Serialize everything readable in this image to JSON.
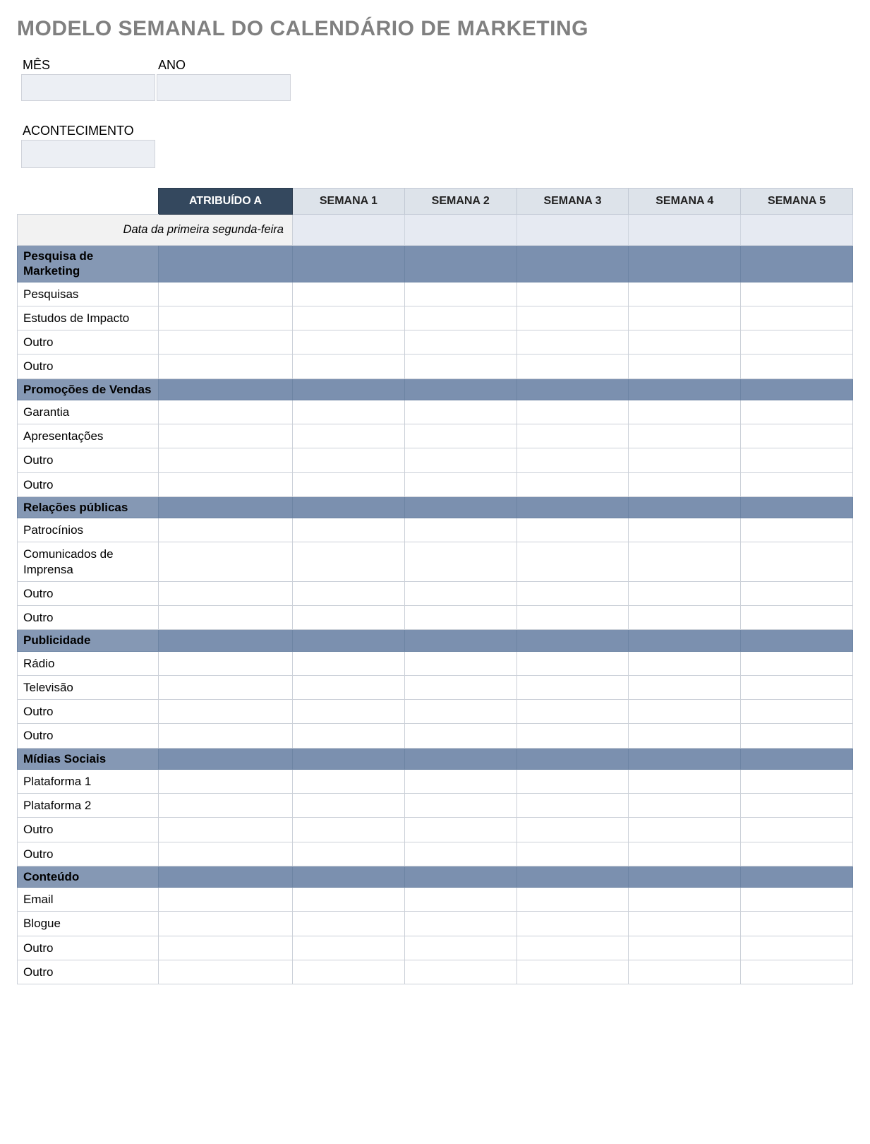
{
  "title": "MODELO SEMANAL DO CALENDÁRIO DE MARKETING",
  "meta": {
    "month_label": "MÊS",
    "month_value": "",
    "year_label": "ANO",
    "year_value": "",
    "event_label": "ACONTECIMENTO",
    "event_value": ""
  },
  "table": {
    "assigned_to_header": "ATRIBUÍDO A",
    "weeks": [
      "SEMANA 1",
      "SEMANA 2",
      "SEMANA 3",
      "SEMANA 4",
      "SEMANA 5"
    ],
    "first_monday_label": "Data da primeira segunda-feira",
    "first_monday_dates": [
      "",
      "",
      "",
      "",
      ""
    ],
    "groups": [
      {
        "title": "Pesquisa de Marketing",
        "rows": [
          {
            "label": "Pesquisas",
            "assigned": "",
            "weeks": [
              "",
              "",
              "",
              "",
              ""
            ]
          },
          {
            "label": "Estudos de Impacto",
            "assigned": "",
            "weeks": [
              "",
              "",
              "",
              "",
              ""
            ]
          },
          {
            "label": "Outro",
            "assigned": "",
            "weeks": [
              "",
              "",
              "",
              "",
              ""
            ]
          },
          {
            "label": "Outro",
            "assigned": "",
            "weeks": [
              "",
              "",
              "",
              "",
              ""
            ]
          }
        ]
      },
      {
        "title": "Promoções de Vendas",
        "rows": [
          {
            "label": "Garantia",
            "assigned": "",
            "weeks": [
              "",
              "",
              "",
              "",
              ""
            ]
          },
          {
            "label": "Apresentações",
            "assigned": "",
            "weeks": [
              "",
              "",
              "",
              "",
              ""
            ]
          },
          {
            "label": "Outro",
            "assigned": "",
            "weeks": [
              "",
              "",
              "",
              "",
              ""
            ]
          },
          {
            "label": "Outro",
            "assigned": "",
            "weeks": [
              "",
              "",
              "",
              "",
              ""
            ]
          }
        ]
      },
      {
        "title": "Relações públicas",
        "rows": [
          {
            "label": "Patrocínios",
            "assigned": "",
            "weeks": [
              "",
              "",
              "",
              "",
              ""
            ]
          },
          {
            "label": "Comunicados de Imprensa",
            "assigned": "",
            "weeks": [
              "",
              "",
              "",
              "",
              ""
            ]
          },
          {
            "label": "Outro",
            "assigned": "",
            "weeks": [
              "",
              "",
              "",
              "",
              ""
            ]
          },
          {
            "label": "Outro",
            "assigned": "",
            "weeks": [
              "",
              "",
              "",
              "",
              ""
            ]
          }
        ]
      },
      {
        "title": "Publicidade",
        "rows": [
          {
            "label": "Rádio",
            "assigned": "",
            "weeks": [
              "",
              "",
              "",
              "",
              ""
            ]
          },
          {
            "label": "Televisão",
            "assigned": "",
            "weeks": [
              "",
              "",
              "",
              "",
              ""
            ]
          },
          {
            "label": "Outro",
            "assigned": "",
            "weeks": [
              "",
              "",
              "",
              "",
              ""
            ]
          },
          {
            "label": "Outro",
            "assigned": "",
            "weeks": [
              "",
              "",
              "",
              "",
              ""
            ]
          }
        ]
      },
      {
        "title": "Mídias Sociais",
        "rows": [
          {
            "label": "Plataforma 1",
            "assigned": "",
            "weeks": [
              "",
              "",
              "",
              "",
              ""
            ]
          },
          {
            "label": "Plataforma 2",
            "assigned": "",
            "weeks": [
              "",
              "",
              "",
              "",
              ""
            ]
          },
          {
            "label": "Outro",
            "assigned": "",
            "weeks": [
              "",
              "",
              "",
              "",
              ""
            ]
          },
          {
            "label": "Outro",
            "assigned": "",
            "weeks": [
              "",
              "",
              "",
              "",
              ""
            ]
          }
        ]
      },
      {
        "title": "Conteúdo",
        "rows": [
          {
            "label": "Email",
            "assigned": "",
            "weeks": [
              "",
              "",
              "",
              "",
              ""
            ]
          },
          {
            "label": "Blogue",
            "assigned": "",
            "weeks": [
              "",
              "",
              "",
              "",
              ""
            ]
          },
          {
            "label": "Outro",
            "assigned": "",
            "weeks": [
              "",
              "",
              "",
              "",
              ""
            ]
          },
          {
            "label": "Outro",
            "assigned": "",
            "weeks": [
              "",
              "",
              "",
              "",
              ""
            ]
          }
        ]
      }
    ]
  }
}
